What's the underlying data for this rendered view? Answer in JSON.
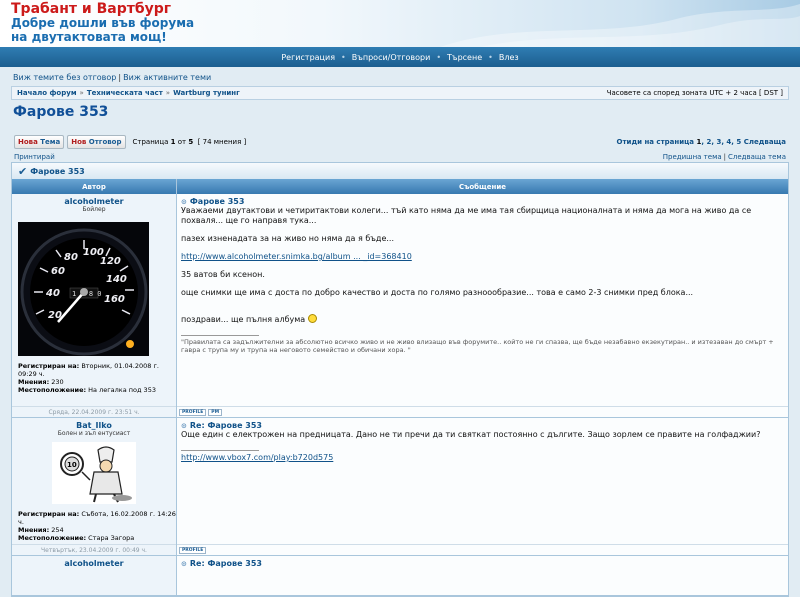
{
  "site": {
    "title": "Трабант и Вартбург",
    "description": "Добре дошли във форума на двутактовата мощ!"
  },
  "navbar": {
    "register": "Регистрация",
    "faq": "Въпроси/Отговори",
    "search": "Търсене",
    "login": "Влез"
  },
  "top_links": {
    "unanswered": "Виж темите без отговор",
    "active": "Виж активните теми"
  },
  "breadcrumbs": {
    "items": [
      "Начало форум",
      "Техническата част",
      "Wartburg тунинг"
    ],
    "timezone": "Часовете са според зоната UTC + 2 часа [ DST ]"
  },
  "topic": {
    "title": "Фарове 353",
    "new_topic_btn": {
      "first": "Нова ",
      "rest": "Тема"
    },
    "reply_btn": {
      "first": "Нов ",
      "rest": "Отговор"
    },
    "page_prefix": "Страница",
    "page_current": "1",
    "page_of": "от",
    "page_total": "5",
    "replies": "[ 74 мнения ]",
    "goto_label": "Отиди на страница",
    "pages": [
      "1",
      "2",
      "3",
      "4",
      "5"
    ],
    "next": "Следваща",
    "print": "Принтирай",
    "prev_topic": "Предишна тема",
    "next_topic": "Следваща тема"
  },
  "table": {
    "category": "Фарове 353",
    "col_author": "Автор",
    "col_message": "Съобщение"
  },
  "posts": [
    {
      "author": "alcoholmeter",
      "rank": "Бойлер",
      "registered_label": "Регистриран на:",
      "registered": "Вторник, 01.04.2008 г. 09:29 ч.",
      "posts_label": "Мнения:",
      "posts": "230",
      "location_label": "Местоположение:",
      "location": "На легалка под 353",
      "date": "Сряда, 22.04.2009 г. 23:51 ч.",
      "subject": "Фарове 353",
      "lines": [
        "Уважаеми двутактови и четиритактови колеги... тъй като няма да ме има тая сбирщица националната и няма да мога на живо да се похваля... ще го направя тука...",
        "пазех изненадата за на живо но няма да я бъде...",
        "http://www.alcoholmeter.snimka.bg/album ... _id=368410",
        "35 ватов би ксенон.",
        "още снимки ще има с доста по добро качество и доста по голямо разноообразие... това е само 2-3 снимки пред блока...",
        "поздрави... ще пълня албума"
      ],
      "signature": "\"Правилата са задължителни за абсолютно всичко живо и не живо влизащо във форумите.. който не ги спазва, ще бъде незабавно екзекутиран.. и изтезаван до смърт + гавра с трупа му и трупа на неговото семейство и обичани хора. \"",
      "btn_profile": "PROFILE",
      "btn_pm": "PM"
    },
    {
      "author": "Bat_Ilko",
      "rank": "Болен и зъл ентусиаст",
      "registered_label": "Регистриран на:",
      "registered": "Събота, 16.02.2008 г. 14:26 ч.",
      "posts_label": "Мнения:",
      "posts": "254",
      "location_label": "Местоположение:",
      "location": "Стара Загора",
      "date": "Четвъртък, 23.04.2009 г. 00:49 ч.",
      "subject": "Re: Фарове 353",
      "lines": [
        "Още един с електрожен на предницата. Дано не ти пречи да ти святкат постоянно с дългите. Защо зорлем се правите на голфаджии?",
        "http://www.vbox7.com/play:b720d575"
      ],
      "btn_profile": "PROFILE"
    },
    {
      "author": "alcoholmeter",
      "subject": "Re: Фарове 353"
    }
  ],
  "gauge": {
    "labels": [
      "20",
      "40",
      "60",
      "80",
      "100",
      "120",
      "140",
      "160"
    ],
    "center_text": "1 2 8 0"
  },
  "colors": {
    "accent": "#105289",
    "nav_bg": "#2f7db3",
    "header_red": "#cc1a1a"
  }
}
